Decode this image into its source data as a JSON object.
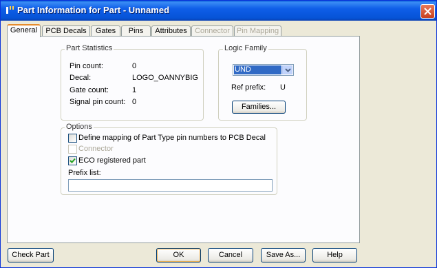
{
  "window": {
    "title": "Part Information for Part - Unnamed"
  },
  "tabs": [
    {
      "label": "General",
      "active": true,
      "enabled": true
    },
    {
      "label": "PCB Decals",
      "active": false,
      "enabled": true
    },
    {
      "label": "Gates",
      "active": false,
      "enabled": true
    },
    {
      "label": "Pins",
      "active": false,
      "enabled": true
    },
    {
      "label": "Attributes",
      "active": false,
      "enabled": true
    },
    {
      "label": "Connector",
      "active": false,
      "enabled": false
    },
    {
      "label": "Pin Mapping",
      "active": false,
      "enabled": false
    }
  ],
  "part_statistics": {
    "title": "Part Statistics",
    "rows": [
      {
        "label": "Pin count:",
        "value": "0"
      },
      {
        "label": "Decal:",
        "value": "LOGO_OANNYBIG"
      },
      {
        "label": "Gate count:",
        "value": "1"
      },
      {
        "label": "Signal pin count:",
        "value": "0"
      }
    ]
  },
  "logic_family": {
    "title": "Logic Family",
    "selected": "UND",
    "ref_prefix_label": "Ref prefix:",
    "ref_prefix_value": "U",
    "families_button": "Families..."
  },
  "options": {
    "title": "Options",
    "define_mapping": {
      "label": "Define mapping of Part Type pin numbers to PCB Decal",
      "checked": false,
      "enabled": true
    },
    "connector": {
      "label": "Connector",
      "checked": false,
      "enabled": false
    },
    "eco_registered": {
      "label": "ECO registered part",
      "checked": true,
      "enabled": true
    },
    "prefix_list_label": "Prefix list:",
    "prefix_list_value": ""
  },
  "buttons": {
    "check_part": "Check Part",
    "ok": "OK",
    "cancel": "Cancel",
    "save_as": "Save As...",
    "help": "Help"
  },
  "colors": {
    "titlebar": "#0653d6",
    "tab_highlight": "#e68b2c",
    "selection": "#316ac5"
  }
}
